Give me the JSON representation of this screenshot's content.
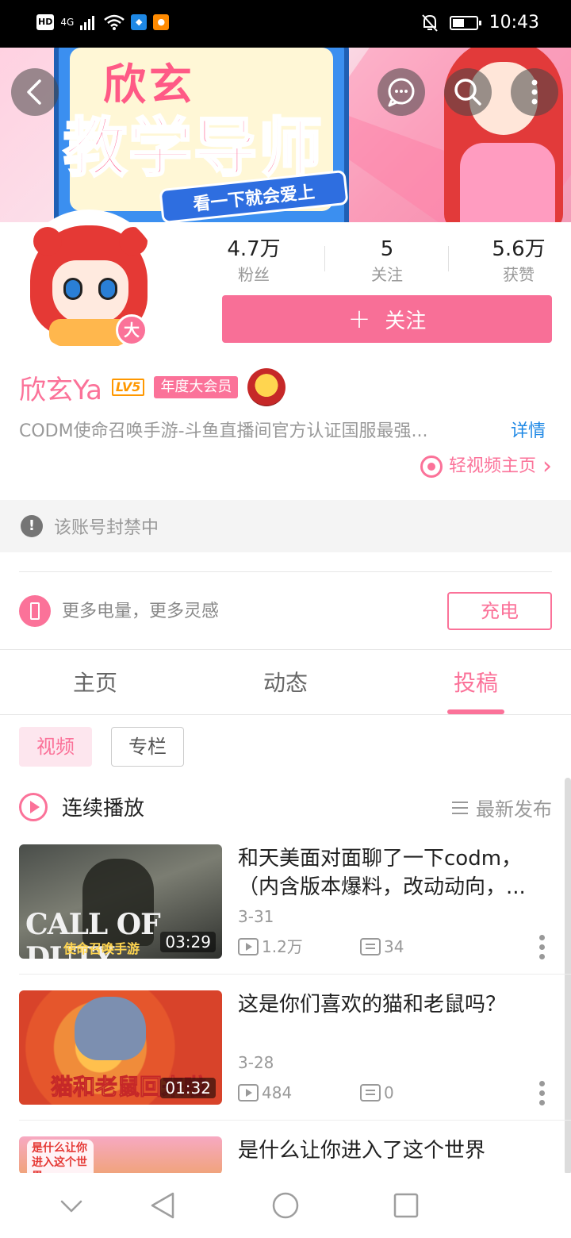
{
  "status_bar": {
    "left_icons": [
      "HD",
      "4G",
      "signal-icon",
      "wifi-icon",
      "shield-app-icon",
      "uc-app-icon"
    ],
    "hd": "HD",
    "network": "4G",
    "time": "10:43",
    "battery_level": 0.5,
    "right_icons": [
      "mute-bell-icon",
      "battery-icon"
    ]
  },
  "banner": {
    "title_line1": "欣玄",
    "title_line2": "教学导师",
    "ribbon": "看一下就会爱上"
  },
  "header_buttons": [
    "back-icon",
    "chat-icon",
    "search-icon",
    "more-vertical-icon"
  ],
  "avatar_badge": "大",
  "stats": [
    {
      "value": "4.7万",
      "label": "粉丝"
    },
    {
      "value": "5",
      "label": "关注"
    },
    {
      "value": "5.6万",
      "label": "获赞"
    }
  ],
  "follow_button": {
    "plus": "+",
    "label": "关注"
  },
  "profile": {
    "name": "欣玄Ya",
    "level": "LV5",
    "vip": "年度大会员",
    "description": "CODM使命召唤手游-斗鱼直播间官方认证国服最强...",
    "more_link": "详情",
    "light_video_link": "轻视频主页",
    "chevron": "›"
  },
  "banned_notice": {
    "icon": "!",
    "text": "该账号封禁中"
  },
  "charge": {
    "text": "更多电量，更多灵感",
    "button": "充电"
  },
  "tabs": [
    {
      "label": "主页",
      "active": false
    },
    {
      "label": "动态",
      "active": false
    },
    {
      "label": "投稿",
      "active": true
    }
  ],
  "filters": [
    {
      "label": "视频",
      "active": true
    },
    {
      "label": "专栏",
      "active": false
    }
  ],
  "continuous_play": "连续播放",
  "sort_label": "最新发布",
  "videos": [
    {
      "title": "和天美面对面聊了一下codm，（内含版本爆料，改动动向，...",
      "date": "3-31",
      "plays": "1.2万",
      "comments": "34",
      "duration": "03:29",
      "thumb_text": "CALL OF DUTY",
      "thumb_sub": "使命召唤手游"
    },
    {
      "title": "这是你们喜欢的猫和老鼠吗？",
      "date": "3-28",
      "plays": "484",
      "comments": "0",
      "duration": "01:32",
      "thumb_text": "猫和老鼠回来啦"
    },
    {
      "title": "是什么让你进入了这个世界",
      "thumb_text": "是什么让你进入这个世界"
    }
  ],
  "accent_color": "#fb7299",
  "nav_icons": [
    "nav-down-icon",
    "nav-back-icon",
    "nav-home-icon",
    "nav-recents-icon"
  ]
}
